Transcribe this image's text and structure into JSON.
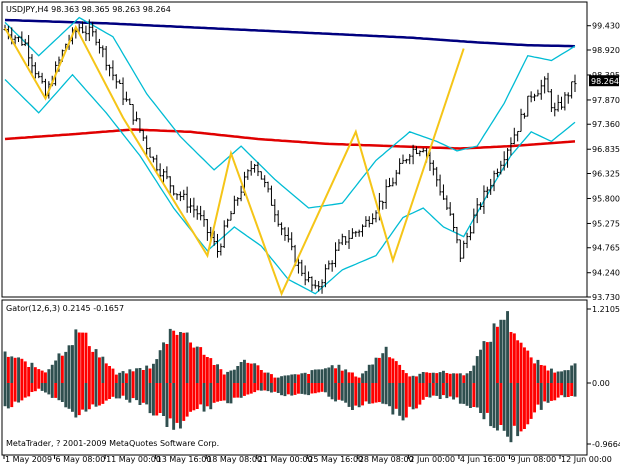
{
  "window": {
    "main_header": "USDJPY,H4  98.363 98.365 98.263 98.264",
    "gator_header": "Gator(12,6,3) 0.2145 -0.1657",
    "copyright": "MetaTrader, ? 2001-2009 MetaQuotes Software Corp."
  },
  "colors": {
    "background": "#ffffff",
    "candles": "#000000",
    "bollinger": "#00bcd4",
    "ma_fast": "#e00000",
    "ma_slow": "#00007f",
    "zigzag": "#f5c518",
    "gator_up": "#ff0000",
    "gator_down": "#2f4f4f",
    "current_price_label": "#000000"
  },
  "chart_data": [
    {
      "type": "candlestick",
      "title": "USDJPY,H4",
      "header_values": {
        "open": 98.363,
        "high": 98.365,
        "low": 98.263,
        "close": 98.264
      },
      "current_price_label": "98.264",
      "ytick_labels": [
        "99.430",
        "98.920",
        "98.395",
        "97.870",
        "97.360",
        "96.835",
        "96.325",
        "95.800",
        "95.275",
        "94.765",
        "94.240",
        "93.730"
      ],
      "ylim": [
        93.73,
        99.55
      ],
      "xtick_labels": [
        "1 May 2009",
        "6 May 08:00",
        "11 May 00:00",
        "13 May 16:00",
        "18 May 08:00",
        "21 May 00:00",
        "25 May 16:00",
        "28 May 08:00",
        "2 Jun 00:00",
        "4 Jun 16:00",
        "9 Jun 08:00",
        "12 Jun 00:00"
      ],
      "bars": 170,
      "close_path": [
        [
          0,
          99.35
        ],
        [
          6,
          99.05
        ],
        [
          12,
          97.95
        ],
        [
          18,
          99.05
        ],
        [
          22,
          99.4
        ],
        [
          27,
          99.2
        ],
        [
          32,
          98.4
        ],
        [
          38,
          97.55
        ],
        [
          44,
          96.6
        ],
        [
          50,
          96.0
        ],
        [
          57,
          95.5
        ],
        [
          63,
          94.7
        ],
        [
          66,
          95.3
        ],
        [
          70,
          96.0
        ],
        [
          74,
          96.6
        ],
        [
          78,
          95.9
        ],
        [
          82,
          95.2
        ],
        [
          86,
          94.5
        ],
        [
          92,
          93.85
        ],
        [
          96,
          94.4
        ],
        [
          100,
          94.9
        ],
        [
          106,
          95.2
        ],
        [
          112,
          95.8
        ],
        [
          116,
          96.3
        ],
        [
          120,
          96.8
        ],
        [
          124,
          96.9
        ],
        [
          128,
          96.2
        ],
        [
          132,
          95.4
        ],
        [
          135,
          94.6
        ],
        [
          139,
          95.4
        ],
        [
          143,
          96.0
        ],
        [
          147,
          96.6
        ],
        [
          152,
          97.3
        ],
        [
          156,
          98.0
        ],
        [
          160,
          98.2
        ],
        [
          163,
          97.6
        ],
        [
          166,
          97.9
        ],
        [
          169,
          98.26
        ]
      ],
      "zigzag": [
        [
          0,
          99.38
        ],
        [
          12,
          97.9
        ],
        [
          21,
          99.4
        ],
        [
          35,
          97.5
        ],
        [
          60,
          94.6
        ],
        [
          67,
          96.75
        ],
        [
          82,
          93.8
        ],
        [
          104,
          97.2
        ],
        [
          115,
          94.5
        ],
        [
          136,
          98.95
        ]
      ],
      "ma_fast_path": [
        [
          0,
          97.05
        ],
        [
          20,
          97.15
        ],
        [
          38,
          97.25
        ],
        [
          55,
          97.2
        ],
        [
          75,
          97.05
        ],
        [
          95,
          96.95
        ],
        [
          115,
          96.9
        ],
        [
          135,
          96.85
        ],
        [
          150,
          96.9
        ],
        [
          169,
          97.0
        ]
      ],
      "ma_slow_path": [
        [
          0,
          99.55
        ],
        [
          30,
          99.48
        ],
        [
          60,
          99.38
        ],
        [
          90,
          99.28
        ],
        [
          120,
          99.18
        ],
        [
          140,
          99.08
        ],
        [
          155,
          99.02
        ],
        [
          169,
          99.0
        ]
      ],
      "bollinger_upper_path": [
        [
          0,
          99.5
        ],
        [
          10,
          98.8
        ],
        [
          22,
          99.6
        ],
        [
          32,
          99.2
        ],
        [
          42,
          98.0
        ],
        [
          52,
          97.1
        ],
        [
          62,
          96.4
        ],
        [
          70,
          96.9
        ],
        [
          80,
          96.2
        ],
        [
          90,
          95.6
        ],
        [
          100,
          95.7
        ],
        [
          110,
          96.6
        ],
        [
          120,
          97.2
        ],
        [
          128,
          97.0
        ],
        [
          134,
          96.8
        ],
        [
          140,
          96.9
        ],
        [
          148,
          97.8
        ],
        [
          155,
          98.8
        ],
        [
          162,
          98.7
        ],
        [
          169,
          99.0
        ]
      ],
      "bollinger_lower_path": [
        [
          0,
          98.3
        ],
        [
          10,
          97.6
        ],
        [
          20,
          98.4
        ],
        [
          30,
          97.6
        ],
        [
          40,
          96.7
        ],
        [
          50,
          95.6
        ],
        [
          60,
          94.7
        ],
        [
          68,
          95.2
        ],
        [
          76,
          94.8
        ],
        [
          84,
          94.1
        ],
        [
          92,
          93.8
        ],
        [
          100,
          94.3
        ],
        [
          110,
          94.6
        ],
        [
          118,
          95.4
        ],
        [
          124,
          95.6
        ],
        [
          130,
          95.2
        ],
        [
          136,
          95.0
        ],
        [
          144,
          96.0
        ],
        [
          150,
          96.7
        ],
        [
          156,
          97.2
        ],
        [
          162,
          97.0
        ],
        [
          169,
          97.4
        ]
      ]
    },
    {
      "type": "histogram",
      "title": "Gator(12,6,3)",
      "header_values": {
        "upper": 0.2145,
        "lower": -0.1657
      },
      "ytick_labels": [
        "1.2105",
        "0.00",
        "-0.9664"
      ],
      "ylim": [
        -0.9664,
        1.2105
      ],
      "bars": 170
    }
  ]
}
